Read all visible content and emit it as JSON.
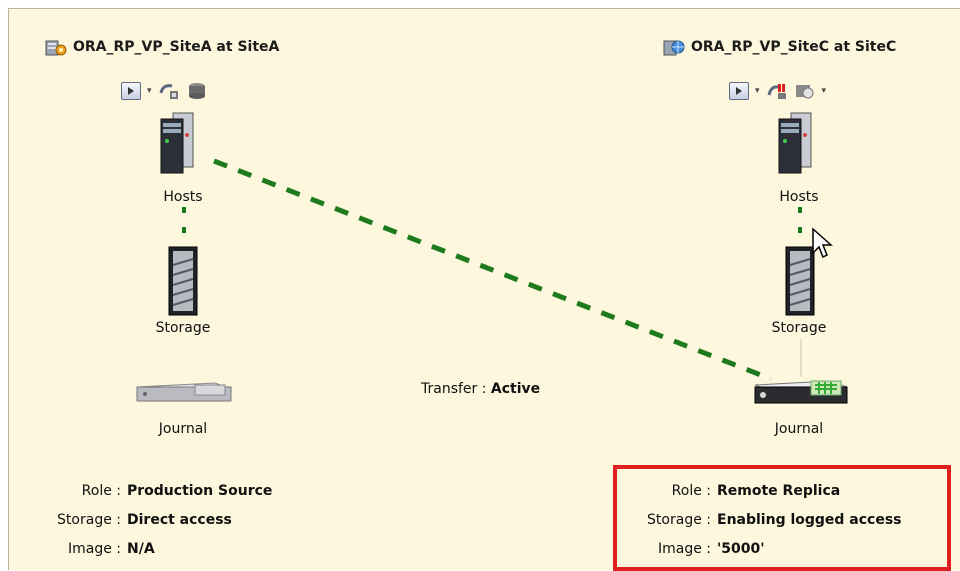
{
  "site_a": {
    "title": "ORA_RP_VP_SiteA at SiteA",
    "hosts_label": "Hosts",
    "storage_label": "Storage",
    "journal_label": "Journal",
    "info": [
      {
        "key": "Role :",
        "value": "Production Source"
      },
      {
        "key": "Storage :",
        "value": "Direct access"
      },
      {
        "key": "Image :",
        "value": "N/A"
      }
    ]
  },
  "site_c": {
    "title": "ORA_RP_VP_SiteC at SiteC",
    "hosts_label": "Hosts",
    "storage_label": "Storage",
    "journal_label": "Journal",
    "info": [
      {
        "key": "Role :",
        "value": "Remote Replica"
      },
      {
        "key": "Storage :",
        "value": "Enabling logged access"
      },
      {
        "key": "Image :",
        "value": "'5000'"
      }
    ]
  },
  "transfer": {
    "label": "Transfer :",
    "status": "Active"
  },
  "icons": {
    "site_a_icon": "site-gear-icon",
    "site_c_icon": "site-globe-icon",
    "host": "server-icon",
    "storage": "storage-array-icon",
    "journal": "journal-appliance-icon",
    "console": "console-icon",
    "cursor": "mouse-cursor-icon"
  },
  "colors": {
    "background": "#fcf7dd",
    "link_line": "#1d7a1d",
    "highlight_box": "#e02020"
  }
}
